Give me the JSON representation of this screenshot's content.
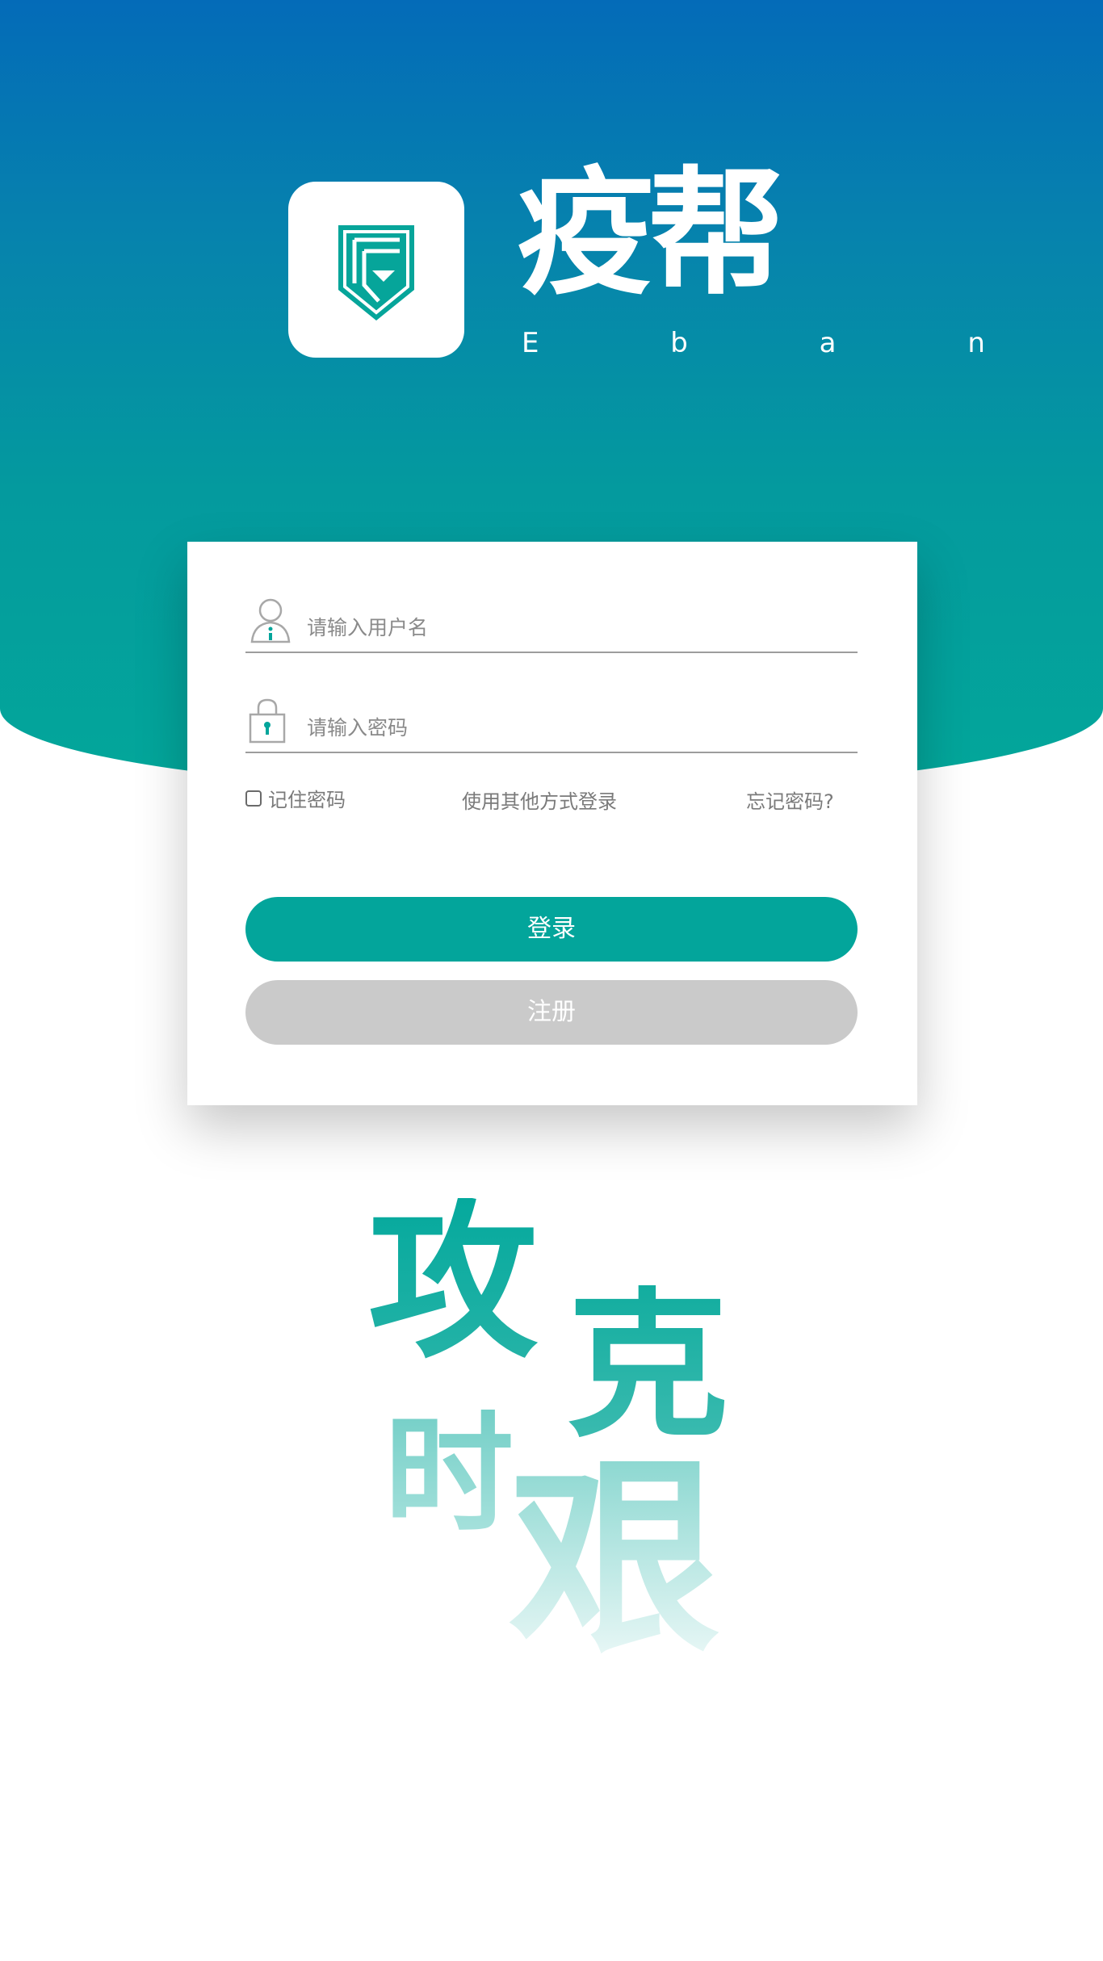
{
  "brand": {
    "name": "疫帮",
    "subtitle": "E b a n"
  },
  "login_form": {
    "username_placeholder": "请输入用户名",
    "password_placeholder": "请输入密码",
    "remember_label": "记住密码",
    "other_login_label": "使用其他方式登录",
    "forgot_label": "忘记密码?",
    "login_button": "登录",
    "register_button": "注册"
  },
  "slogan": {
    "char1": "攻",
    "char2": "克",
    "char3": "时",
    "char4": "艰"
  },
  "colors": {
    "header_top": "#046bb8",
    "header_bottom": "#03a79a",
    "primary": "#03a59b",
    "secondary_button": "#cacaca"
  }
}
